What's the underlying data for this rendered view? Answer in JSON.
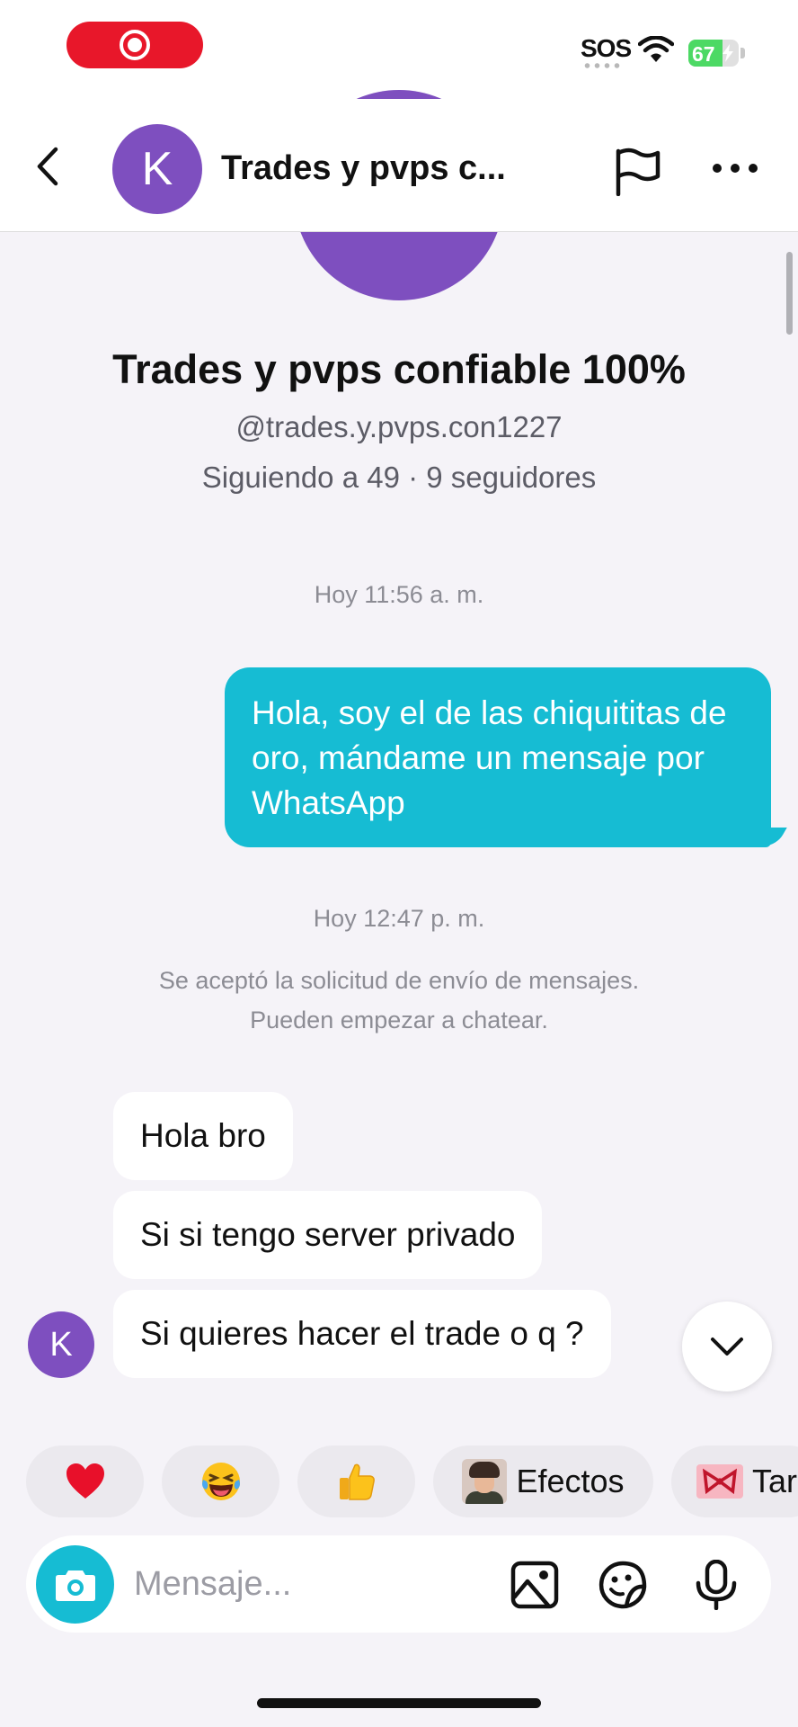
{
  "status_bar": {
    "sos": "SOS",
    "battery": "67",
    "battery_level": 0.67
  },
  "header": {
    "title": "Trades y pvps c...",
    "avatar_letter": "K"
  },
  "profile": {
    "avatar_letter": "K",
    "name": "Trades y pvps confiable 100%",
    "handle": "@trades.y.pvps.con1227",
    "following": "Siguiendo a 49",
    "separator": "·",
    "followers": "9 seguidores"
  },
  "chat": {
    "timestamp_1": "Hoy 11:56 a. m.",
    "outgoing": "Hola, soy el de las chiquititas de oro, mándame un mensaje por WhatsApp",
    "timestamp_2": "Hoy 12:47 p. m.",
    "notice_line_1": "Se aceptó la solicitud de envío de mensajes.",
    "notice_line_2": "Pueden empezar a chatear.",
    "incoming": [
      "Hola bro",
      "Si si tengo server privado",
      "Si quieres hacer el trade o q ?"
    ],
    "sender_avatar_letter": "K"
  },
  "quick_replies": {
    "heart": "heart-emoji",
    "laugh": "laughing-emoji",
    "thumbs": "thumbs-up-emoji",
    "effects": "Efectos",
    "next": "Tar"
  },
  "composer": {
    "placeholder": "Mensaje..."
  },
  "colors": {
    "accent": "#16bcd3",
    "avatar": "#7e4fbf",
    "record": "#e8172a",
    "battery": "#4cd964",
    "background": "#f5f3f8"
  }
}
